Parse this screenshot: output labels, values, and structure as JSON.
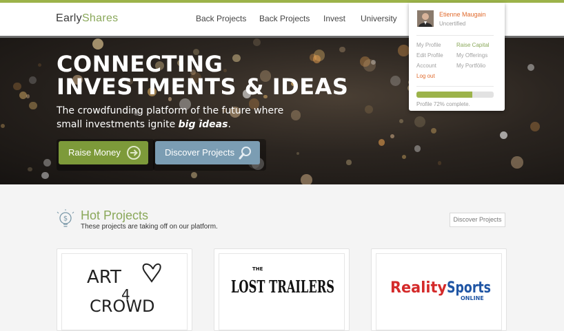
{
  "brand": {
    "name_prefix": "Early",
    "name_suffix": "Shares",
    "accent": "#9cb34a"
  },
  "nav": {
    "items": [
      "Back Projects",
      "Back Projects",
      "Invest",
      "University"
    ]
  },
  "hero": {
    "title": "CONNECTING INVESTMENTS & IDEAS",
    "subtitle_main": "The crowdfunding platform of the future where small investments ignite",
    "subtitle_em": "big ideas",
    "subtitle_end": ".",
    "raise_button": "Raise Money",
    "discover_button": "Discover Projects",
    "raise_color": "#7d9a3a",
    "discover_color": "#7b9db3"
  },
  "section": {
    "title": "Hot Projects",
    "subtitle": "These projects are taking off on our platform.",
    "discover_button": "Discover Projects"
  },
  "projects": [
    {
      "logo_text_1": "ART",
      "logo_text_2": "4",
      "logo_text_3": "CROWD"
    },
    {
      "logo_small": "THE",
      "logo_text": "LOST TRAILERS"
    },
    {
      "logo_text_1": "Reality",
      "logo_text_2": "Sports",
      "logo_text_3": "ONLINE"
    }
  ],
  "user_menu": {
    "name": "Etienne Maugain",
    "status": "Uncertified",
    "links_left": [
      "My Profile",
      "Edit Profile",
      "Account",
      "Log out"
    ],
    "links_right": [
      "Raise Capital",
      "My Offerings",
      "My Portfölio"
    ],
    "progress_percent": 72,
    "progress_text": "Profile 72% complete.",
    "progress_color": "#9cb34a"
  }
}
